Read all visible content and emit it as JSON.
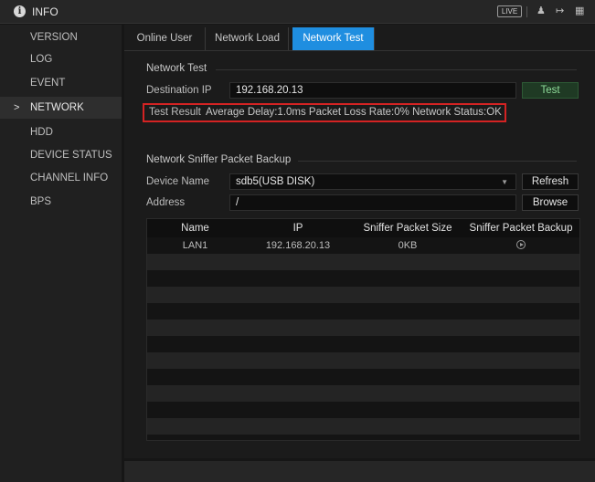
{
  "titlebar": {
    "title": "INFO",
    "live_label": "LIVE",
    "icons": [
      "info-icon",
      "user-icon",
      "exit-icon",
      "grid-icon"
    ]
  },
  "sidebar": {
    "items": [
      {
        "label": "VERSION",
        "active": false
      },
      {
        "label": "LOG",
        "active": false
      },
      {
        "label": "EVENT",
        "active": false
      },
      {
        "label": "NETWORK",
        "active": true
      },
      {
        "label": "HDD",
        "active": false
      },
      {
        "label": "DEVICE STATUS",
        "active": false
      },
      {
        "label": "CHANNEL INFO",
        "active": false
      },
      {
        "label": "BPS",
        "active": false
      }
    ],
    "active_marker": ">"
  },
  "tabs": [
    {
      "label": "Online User",
      "active": false
    },
    {
      "label": "Network Load",
      "active": false
    },
    {
      "label": "Network Test",
      "active": true
    }
  ],
  "network_test": {
    "section_title": "Network Test",
    "destination_label": "Destination IP",
    "destination_value": "192.168.20.13",
    "test_button": "Test",
    "result_label": "Test Result",
    "result_text": "Average Delay:1.0ms  Packet Loss Rate:0%  Network Status:OK"
  },
  "sniffer": {
    "section_title": "Network Sniffer Packet Backup",
    "device_label": "Device Name",
    "device_value": "sdb5(USB DISK)",
    "refresh_button": "Refresh",
    "address_label": "Address",
    "address_value": "/",
    "browse_button": "Browse",
    "columns": [
      "Name",
      "IP",
      "Sniffer Packet Size",
      "Sniffer Packet Backup"
    ],
    "rows": [
      {
        "name": "LAN1",
        "ip": "192.168.20.13",
        "size": "0KB",
        "backup_icon": "play-icon"
      }
    ]
  },
  "colors": {
    "accent": "#1f8ee0",
    "highlight_border": "#d42323",
    "test_button_text": "#8fdc9a"
  }
}
